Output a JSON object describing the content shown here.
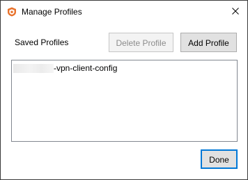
{
  "window": {
    "title": "Manage Profiles",
    "icon": "shield-logo-icon",
    "close_icon": "close-icon",
    "accent_color": "#e8712a"
  },
  "profiles": {
    "label": "Saved Profiles",
    "delete_label": "Delete Profile",
    "add_label": "Add Profile",
    "items": [
      {
        "visible_suffix": "-vpn-client-config",
        "prefix_redacted": true
      }
    ]
  },
  "footer": {
    "done_label": "Done",
    "focus_color": "#0078d7"
  }
}
